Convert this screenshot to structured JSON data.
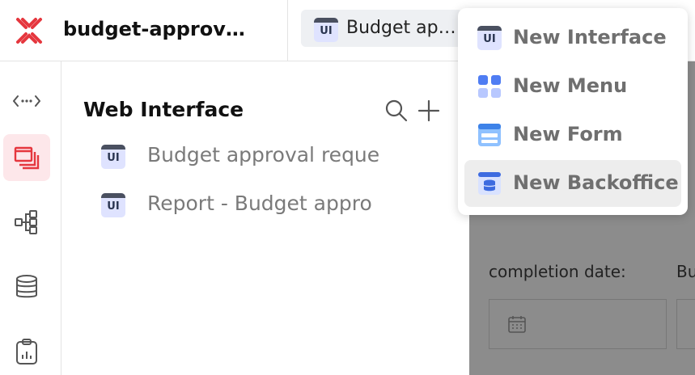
{
  "header": {
    "app_title": "budget-approv…",
    "doc_tab_label": "Budget ap…"
  },
  "rail": {
    "icons": [
      "expand-collapse-icon",
      "web-interface-icon",
      "workflow-icon",
      "database-icon",
      "clipboard-report-icon"
    ],
    "active_color": "#fde7ea",
    "accent_color": "#e5373e"
  },
  "panel": {
    "title": "Web Interface",
    "items": [
      {
        "icon_text": "UI",
        "label": "Budget approval reque"
      },
      {
        "icon_text": "UI",
        "label": "Report - Budget appro"
      }
    ]
  },
  "background_form": {
    "completion_label": "completion date:",
    "second_label": "Bu"
  },
  "menu": {
    "items": [
      {
        "label": "New Interface",
        "icon": "interface-icon",
        "icon_text": "UI"
      },
      {
        "label": "New Menu",
        "icon": "menu-grid-icon"
      },
      {
        "label": "New Form",
        "icon": "form-icon"
      },
      {
        "label": "New Backoffice",
        "icon": "backoffice-icon",
        "hovered": true
      }
    ]
  }
}
